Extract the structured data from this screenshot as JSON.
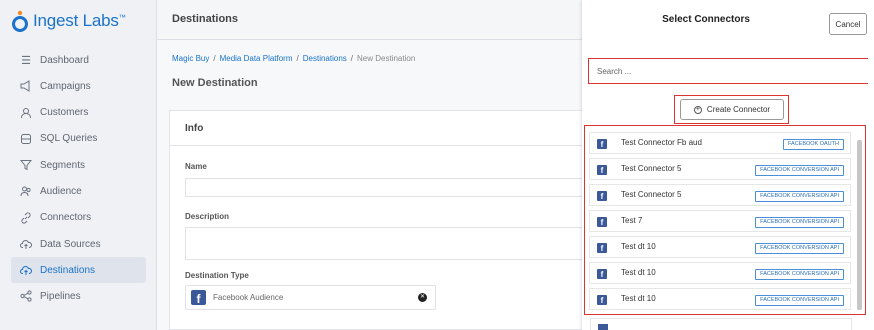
{
  "app": {
    "logo_text": "Ingest Labs",
    "trademark": "™"
  },
  "sidebar": {
    "items": [
      {
        "label": "Dashboard",
        "icon": "list-icon"
      },
      {
        "label": "Campaigns",
        "icon": "megaphone-icon"
      },
      {
        "label": "Customers",
        "icon": "user-icon"
      },
      {
        "label": "SQL Queries",
        "icon": "database-icon"
      },
      {
        "label": "Segments",
        "icon": "filter-icon"
      },
      {
        "label": "Audience",
        "icon": "users-icon"
      },
      {
        "label": "Connectors",
        "icon": "link-icon"
      },
      {
        "label": "Data Sources",
        "icon": "cloud-upload-icon"
      },
      {
        "label": "Destinations",
        "icon": "cloud-upload-icon",
        "active": true
      },
      {
        "label": "Pipelines",
        "icon": "share-icon"
      }
    ]
  },
  "topbar": {
    "title": "Destinations"
  },
  "breadcrumb": {
    "b1": "Magic Buy",
    "b2": "Media Data Platform",
    "b3": "Destinations",
    "b4": "New Destination",
    "sep": "/"
  },
  "page": {
    "title": "New Destination",
    "card_title": "Info",
    "name_label": "Name",
    "description_label": "Description",
    "destination_type_label": "Destination Type",
    "destination_type_value": "Facebook Audience"
  },
  "panel": {
    "title": "Select Connectors",
    "cancel_label": "Cancel",
    "search_placeholder": "Search ...",
    "create_label": "Create Connector",
    "connectors": [
      {
        "name": "Test Connector Fb aud",
        "type": "FACEBOOK OAUTH"
      },
      {
        "name": "Test Connector 5",
        "type": "FACEBOOK CONVERSION API"
      },
      {
        "name": "Test Connector 5",
        "type": "FACEBOOK CONVERSION API"
      },
      {
        "name": "Test 7",
        "type": "FACEBOOK CONVERSION API"
      },
      {
        "name": "Test dt 10",
        "type": "FACEBOOK CONVERSION API"
      },
      {
        "name": "Test dt 10",
        "type": "FACEBOOK CONVERSION API"
      },
      {
        "name": "Test dt 10",
        "type": "FACEBOOK CONVERSION API"
      }
    ]
  },
  "colors": {
    "brand": "#1a73c9",
    "facebook": "#3b5998",
    "highlight": "#dd3333"
  }
}
